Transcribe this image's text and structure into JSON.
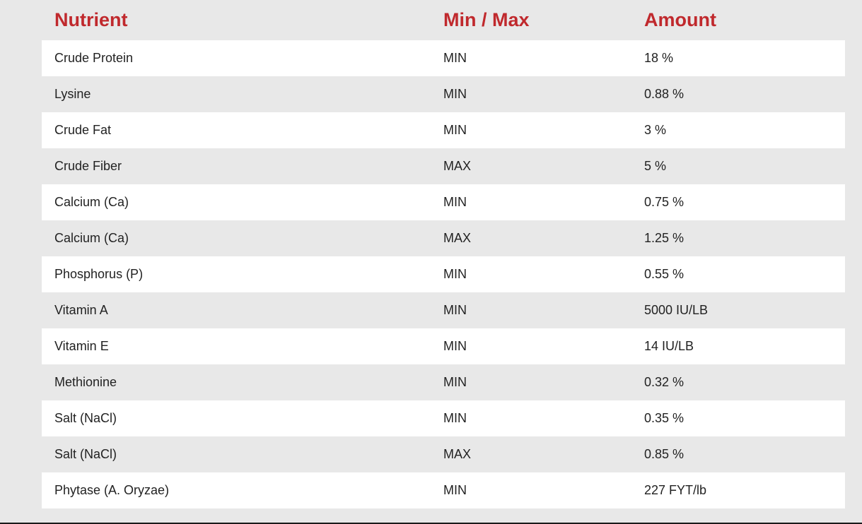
{
  "table": {
    "headers": {
      "nutrient": "Nutrient",
      "minmax": "Min / Max",
      "amount": "Amount"
    },
    "rows": [
      {
        "nutrient": "Crude Protein",
        "minmax": "MIN",
        "amount": "18 %"
      },
      {
        "nutrient": "Lysine",
        "minmax": "MIN",
        "amount": "0.88 %"
      },
      {
        "nutrient": "Crude Fat",
        "minmax": "MIN",
        "amount": "3 %"
      },
      {
        "nutrient": "Crude Fiber",
        "minmax": "MAX",
        "amount": "5 %"
      },
      {
        "nutrient": "Calcium (Ca)",
        "minmax": "MIN",
        "amount": "0.75 %"
      },
      {
        "nutrient": "Calcium (Ca)",
        "minmax": "MAX",
        "amount": "1.25 %"
      },
      {
        "nutrient": "Phosphorus (P)",
        "minmax": "MIN",
        "amount": "0.55 %"
      },
      {
        "nutrient": "Vitamin A",
        "minmax": "MIN",
        "amount": "5000 IU/LB"
      },
      {
        "nutrient": "Vitamin E",
        "minmax": "MIN",
        "amount": "14 IU/LB"
      },
      {
        "nutrient": "Methionine",
        "minmax": "MIN",
        "amount": "0.32 %"
      },
      {
        "nutrient": "Salt (NaCl)",
        "minmax": "MIN",
        "amount": "0.35 %"
      },
      {
        "nutrient": "Salt (NaCl)",
        "minmax": "MAX",
        "amount": "0.85 %"
      },
      {
        "nutrient": "Phytase (A. Oryzae)",
        "minmax": "MIN",
        "amount": "227 FYT/lb"
      }
    ]
  },
  "colors": {
    "header_text": "#c0292d",
    "row_alt": "#ffffff",
    "background": "#e8e8e8"
  }
}
